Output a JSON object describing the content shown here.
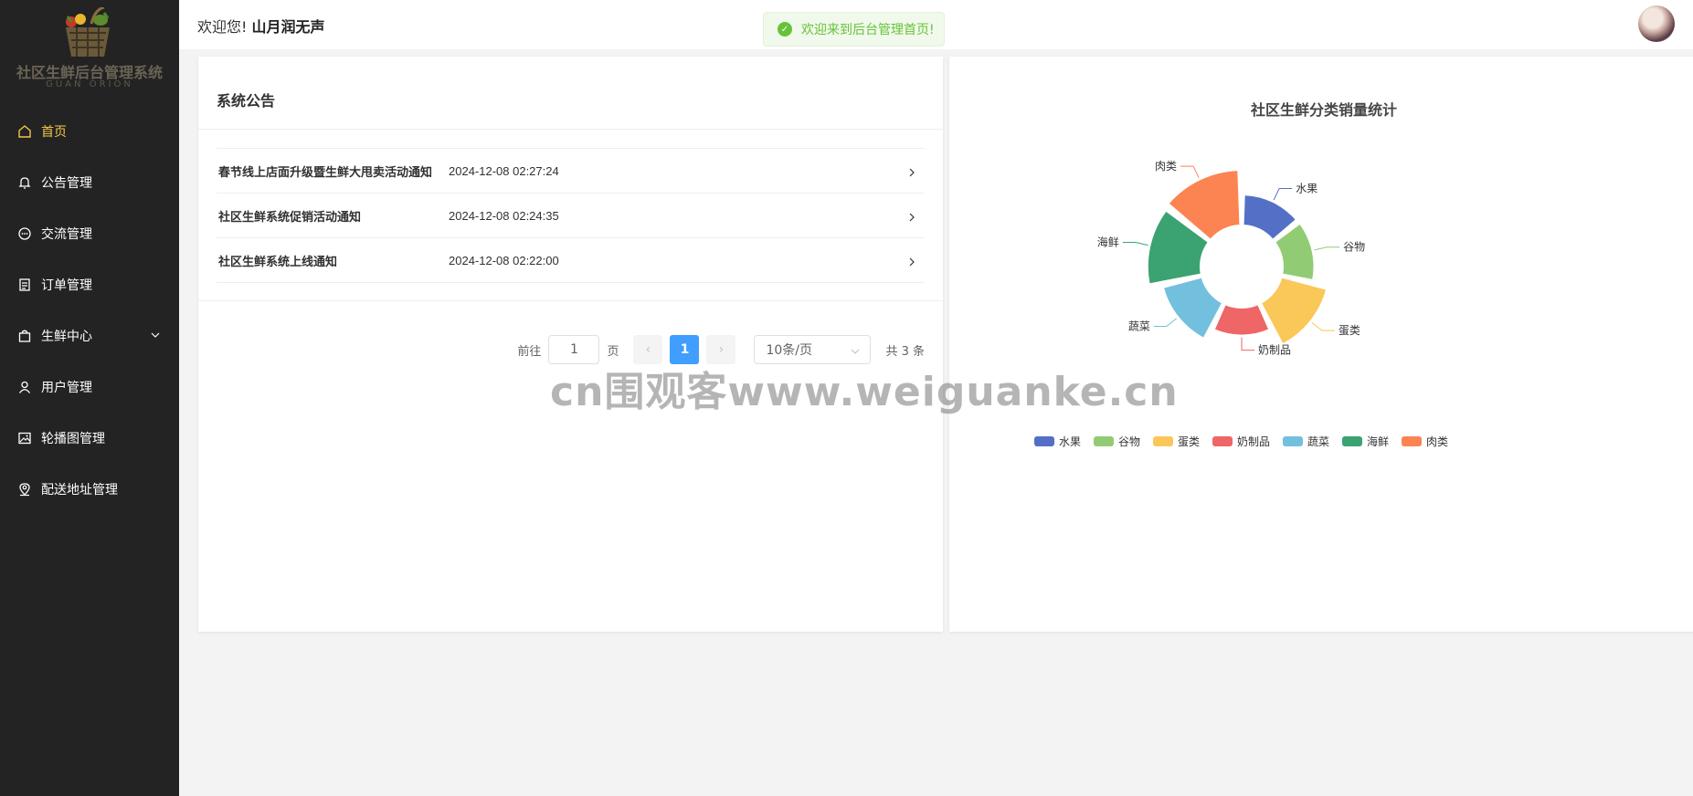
{
  "app": {
    "logo_title": "社区生鲜后台管理系统",
    "logo_subtitle": "GUAN ORION"
  },
  "sidebar": {
    "items": [
      {
        "label": "首页",
        "icon": "home-icon",
        "active": true
      },
      {
        "label": "公告管理",
        "icon": "bell-icon"
      },
      {
        "label": "交流管理",
        "icon": "chat-icon"
      },
      {
        "label": "订单管理",
        "icon": "document-icon"
      },
      {
        "label": "生鲜中心",
        "icon": "bag-icon",
        "expandable": true
      },
      {
        "label": "用户管理",
        "icon": "user-icon"
      },
      {
        "label": "轮播图管理",
        "icon": "picture-icon"
      },
      {
        "label": "配送地址管理",
        "icon": "location-icon"
      }
    ]
  },
  "header": {
    "greeting": "欢迎您!",
    "username": "山月润无声",
    "toast": "欢迎来到后台管理首页!"
  },
  "notice": {
    "title": "系统公告",
    "rows": [
      {
        "title": "春节线上店面升级暨生鲜大甩卖活动通知",
        "date": "2024-12-08 02:27:24"
      },
      {
        "title": "社区生鲜系统促销活动通知",
        "date": "2024-12-08 02:24:35"
      },
      {
        "title": "社区生鲜系统上线通知",
        "date": "2024-12-08 02:22:00"
      }
    ],
    "pagination": {
      "goto_label": "前往",
      "goto_value": "1",
      "page_unit": "页",
      "prev": "‹",
      "current": "1",
      "next": "›",
      "page_size": "10条/页",
      "total": "共 3 条"
    }
  },
  "chart_data": {
    "type": "pie",
    "title": "社区生鲜分类销量统计",
    "donut": true,
    "rose": true,
    "legend_position": "bottom",
    "categories": [
      "水果",
      "谷物",
      "蛋类",
      "奶制品",
      "蔬菜",
      "海鲜",
      "肉类"
    ],
    "values": [
      7,
      8,
      38,
      1,
      25,
      50,
      55
    ],
    "colors": [
      "#5470c6",
      "#91cc75",
      "#fac858",
      "#ee6666",
      "#73c0de",
      "#3ba272",
      "#fc8452"
    ]
  },
  "watermark": "cn围观客www.weiguanke.cn"
}
